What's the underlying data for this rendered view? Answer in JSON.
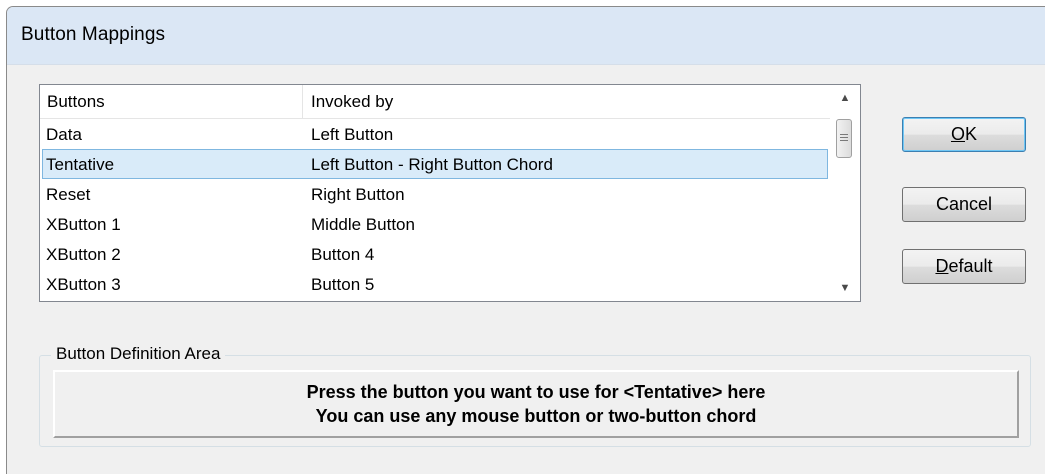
{
  "window": {
    "title": "Button Mappings"
  },
  "list": {
    "columns": [
      "Buttons",
      "Invoked by"
    ],
    "rows": [
      {
        "button": "Data",
        "invoked_by": "Left Button"
      },
      {
        "button": "Tentative",
        "invoked_by": "Left Button - Right Button Chord"
      },
      {
        "button": "Reset",
        "invoked_by": "Right Button"
      },
      {
        "button": "XButton 1",
        "invoked_by": "Middle Button"
      },
      {
        "button": "XButton 2",
        "invoked_by": "Button 4"
      },
      {
        "button": "XButton 3",
        "invoked_by": "Button 5"
      }
    ],
    "selected_index": 1
  },
  "buttons": {
    "ok_label": "OK",
    "cancel_label": "Cancel",
    "default_label": "Default"
  },
  "definition_area": {
    "legend": "Button Definition Area",
    "line1": "Press the button you want to use for <Tentative> here",
    "line2": "You can use any mouse button or two-button chord"
  },
  "icons": {
    "scroll_up": "chevron-up-icon",
    "scroll_down": "chevron-down-icon",
    "scroll_grip": "grip-icon"
  },
  "colors": {
    "titlebar": "#dbe7f5",
    "selection_fill": "#d9ebf9",
    "selection_border": "#7fb7e0",
    "dialog_bg": "#f0f0f0"
  }
}
